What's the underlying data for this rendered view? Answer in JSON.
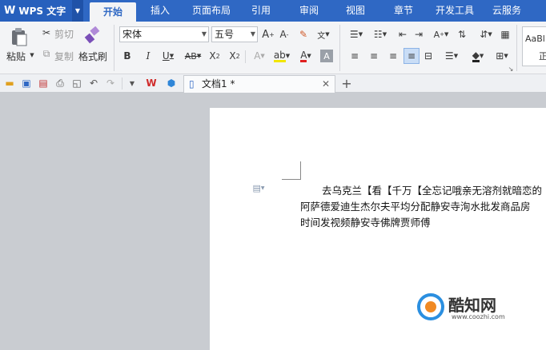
{
  "app": {
    "title": "WPS 文字"
  },
  "tabs": [
    {
      "label": "开始",
      "active": true
    },
    {
      "label": "插入"
    },
    {
      "label": "页面布局"
    },
    {
      "label": "引用"
    },
    {
      "label": "审阅"
    },
    {
      "label": "视图"
    },
    {
      "label": "章节"
    },
    {
      "label": "开发工具"
    },
    {
      "label": "云服务"
    }
  ],
  "clipboard": {
    "paste": "粘贴",
    "cut": "剪切",
    "copy": "复制",
    "format_painter": "格式刷"
  },
  "font": {
    "name": "宋体",
    "size": "五号"
  },
  "styles": {
    "preview": "AaBl",
    "preview2": "正"
  },
  "document": {
    "tab_title": "文档1 *",
    "lines": [
      "去乌克兰【看【千万【全忘记哦亲无溶剂就暗恋的",
      "阿萨德爱迪生杰尔夫平均分配静安寺洵水批发商品房",
      "时间发视频静安寺佛牌贾师傅"
    ]
  },
  "watermark": {
    "text": "酷知网",
    "url": "www.coozhi.com"
  },
  "colors": {
    "tabbar": "#2f68c4",
    "ribbon": "#f3f4f6",
    "workspace": "#c9ccd1"
  }
}
